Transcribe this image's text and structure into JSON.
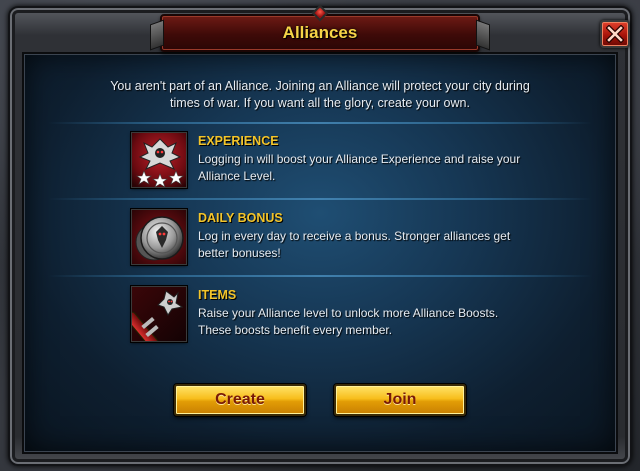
{
  "dialog": {
    "title": "Alliances",
    "intro": "You aren't part of an Alliance. Joining an Alliance will protect your city during times of war. If you want all the glory, create your own."
  },
  "features": [
    {
      "label": "EXPERIENCE",
      "description": "Logging in will boost your Alliance Experience and raise your Alliance Level.",
      "icon": "experience-icon"
    },
    {
      "label": "DAILY BONUS",
      "description": "Log in every day to receive a bonus. Stronger alliances get better bonuses!",
      "icon": "daily-bonus-icon"
    },
    {
      "label": "ITEMS",
      "description": "Raise your Alliance level to unlock more Alliance Boosts. These boosts benefit every member.",
      "icon": "items-icon"
    }
  ],
  "buttons": {
    "create": "Create",
    "join": "Join"
  },
  "colors": {
    "title_text": "#f6d447",
    "feature_label": "#f2c42a",
    "button_text": "#7a1a06",
    "close_button": "#c8200e"
  }
}
